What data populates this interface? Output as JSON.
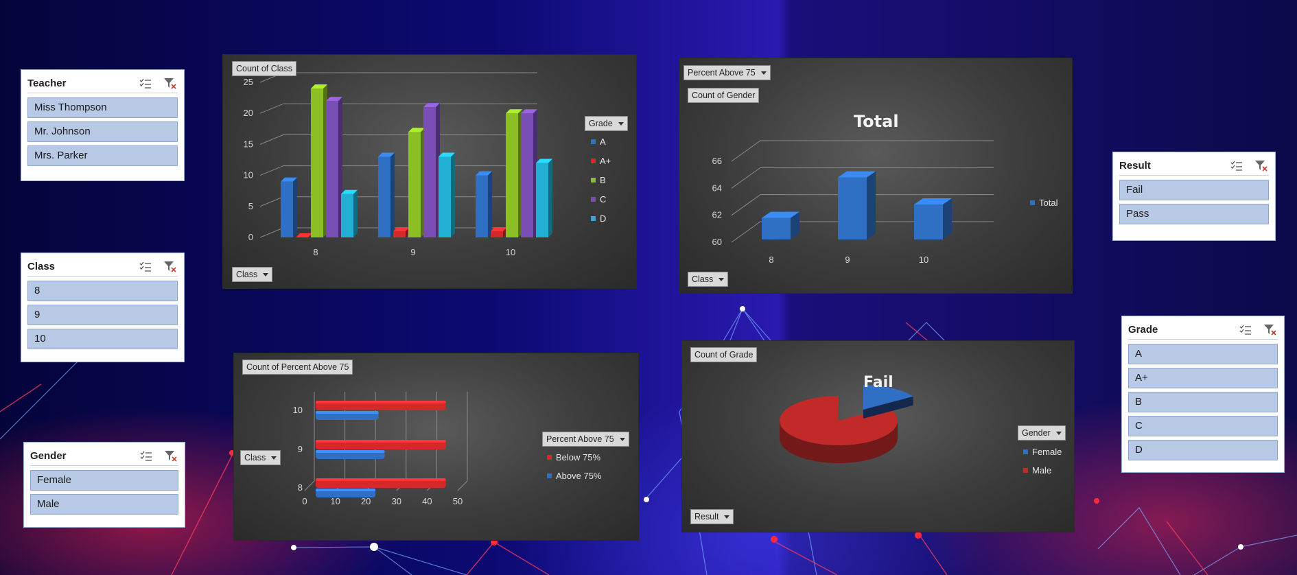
{
  "slicers": {
    "teacher": {
      "title": "Teacher",
      "items": [
        "Miss Thompson",
        "Mr. Johnson",
        "Mrs. Parker"
      ]
    },
    "class": {
      "title": "Class",
      "items": [
        "8",
        "9",
        "10"
      ]
    },
    "gender": {
      "title": "Gender",
      "items": [
        "Female",
        "Male"
      ]
    },
    "result": {
      "title": "Result",
      "items": [
        "Fail",
        "Pass"
      ]
    },
    "grade": {
      "title": "Grade",
      "items": [
        "A",
        "A+",
        "B",
        "C",
        "D"
      ]
    }
  },
  "slicer_icons": {
    "multiselect": "multi-select-icon",
    "clear": "clear-filter-icon"
  },
  "charts": {
    "class_grade": {
      "value_button": "Count of Class",
      "axis_button": "Class",
      "legend_button": "Grade"
    },
    "gender_total": {
      "filter_button": "Percent Above 75",
      "value_button": "Count of Gender",
      "title": "Total",
      "axis_button": "Class"
    },
    "percent_above": {
      "value_button": "Count of Percent Above 75",
      "axis_button": "Class",
      "legend_button": "Percent Above 75"
    },
    "grade_pie": {
      "value_button": "Count of Grade",
      "title": "Fail",
      "axis_button": "Result",
      "legend_button": "Gender"
    }
  },
  "chart_data": [
    {
      "type": "bar",
      "categories": [
        "8",
        "9",
        "10"
      ],
      "series": [
        {
          "name": "A",
          "values": [
            9,
            13,
            10
          ],
          "color": "#2f6fc4"
        },
        {
          "name": "A+",
          "values": [
            0,
            1,
            1
          ],
          "color": "#d22a2a"
        },
        {
          "name": "B",
          "values": [
            24,
            17,
            20
          ],
          "color": "#8cbf26"
        },
        {
          "name": "C",
          "values": [
            22,
            21,
            20
          ],
          "color": "#7a4fb5"
        },
        {
          "name": "D",
          "values": [
            7,
            13,
            12
          ],
          "color": "#21afd4"
        }
      ],
      "yticks": [
        "0",
        "5",
        "10",
        "15",
        "20",
        "25"
      ],
      "ylim": [
        0,
        25
      ]
    },
    {
      "type": "bar",
      "categories": [
        "8",
        "9",
        "10"
      ],
      "series": [
        {
          "name": "Total",
          "values": [
            62,
            65,
            63
          ],
          "color": "#2f6fc4"
        }
      ],
      "yticks": [
        "60",
        "62",
        "64",
        "66"
      ],
      "ylim": [
        60,
        66
      ]
    },
    {
      "type": "bar",
      "orientation": "horizontal",
      "categories": [
        "8",
        "9",
        "10"
      ],
      "series": [
        {
          "name": "Below 75%",
          "values": [
            43,
            43,
            43
          ],
          "color": "#d22a2a"
        },
        {
          "name": "Above 75%",
          "values": [
            20,
            23,
            21
          ],
          "color": "#2f6fc4"
        }
      ],
      "xticks": [
        "0",
        "10",
        "20",
        "30",
        "40",
        "50"
      ],
      "xlim": [
        0,
        50
      ]
    },
    {
      "type": "pie",
      "categories": [
        "Female",
        "Male"
      ],
      "values": [
        16,
        84
      ],
      "colors": [
        "#2f6fc4",
        "#c22a2a"
      ]
    }
  ]
}
